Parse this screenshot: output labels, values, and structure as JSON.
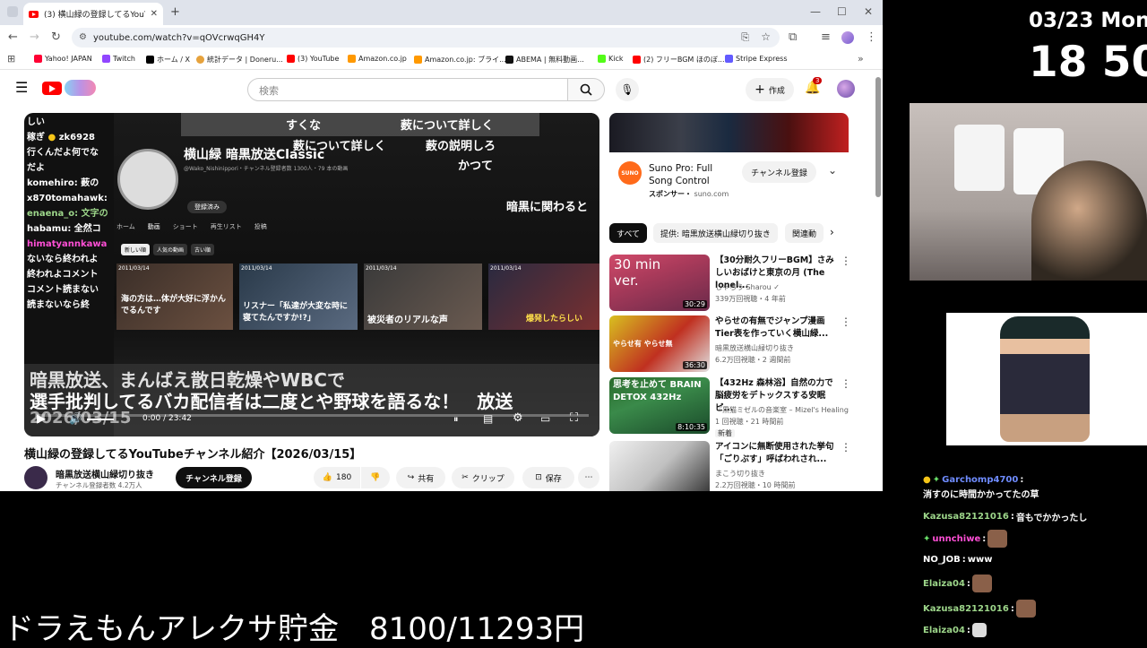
{
  "browser": {
    "tab_title": "(3) 横山緑の登録してるYouTubeチ",
    "url": "youtube.com/watch?v=qOVcrwqGH4Y",
    "bookmarks": [
      "Yahoo! JAPAN",
      "Twitch",
      "ホーム / X",
      "統計データ | Doneru...",
      "(3) YouTube",
      "Amazon.co.jp",
      "Amazon.co.jp: ブライ...",
      "ABEMA | 無料動画...",
      "Kick",
      "(2) フリーBGM ほのぼ...",
      "Stripe Express"
    ]
  },
  "youtube": {
    "search_placeholder": "検索",
    "create_label": "作成",
    "notification_count": "3",
    "video": {
      "title": "横山緑の登録してるYouTubeチャンネル紹介【2026/03/15】",
      "time": "0:00 / 23:42",
      "channel": "暗黒放送横山緑切り抜き",
      "subscribers": "チャンネル登録者数 4.2万人",
      "subscribe_label": "チャンネル登録",
      "likes": "180",
      "share_label": "共有",
      "clip_label": "クリップ",
      "save_label": "保存"
    },
    "overlay": {
      "top_comments": [
        "すくな",
        "薮について詳しく",
        "薮について詳しく",
        "薮の説明しろ",
        "かつて",
        "暗黒に関わると"
      ],
      "channel_name": "横山緑 暗黒放送Classic",
      "handle": "@Wako_Nishinippori・チャンネル登録者数 1300人・79 本の動画",
      "subscribed": "登録済み",
      "nav": [
        "ホーム",
        "動画",
        "ショート",
        "再生リスト",
        "投稿"
      ],
      "filters": [
        "新しい順",
        "人気の動画",
        "古い順"
      ],
      "left_chat": [
        "しい",
        "稼ぎ",
        "zk6928",
        "行くんだよ何でな",
        "だよ",
        "komehiro: 薮の",
        "x870tomahawk:",
        "enaena_o: 文字の",
        "habamu: 全然コ",
        "himatyannkawa",
        "ないなら終われよ",
        "終われよコメント",
        "コメント読まない",
        "読まないなら終"
      ],
      "bottom_text": "暗黒放送、まんばえ散日乾燥やWBCで",
      "bottom_text2": "選手批判してるバカ配信者は二度とや野球を語るな！　放送",
      "date": "2026/03/15",
      "thumb_captions": [
        "海の方は…体が大好に浮かんでるんです",
        "リスナー「私達が大変な時に寝てたんですか!?」",
        "被災者のリアルな声",
        "爆発したらしい"
      ],
      "thumb_dates": [
        "2011/03/14",
        "2011/03/14",
        "2011/03/14",
        "2011/03/14"
      ]
    },
    "ad": {
      "title": "Suno Pro: Full Song Control",
      "sponsor": "スポンサー・",
      "domain": "suno.com",
      "brand": "SUNO",
      "subscribe_label": "チャンネル登録"
    },
    "filter_chips": [
      "すべて",
      "提供: 暗黒放送横山緑切り抜き",
      "関連動"
    ],
    "recommendations": [
      {
        "title": "【30分耐久フリーBGM】さみしいおばけと東京の月 (The lonel...",
        "channel": "しゃろう Sharou",
        "meta": "339万回視聴・4 年前",
        "duration": "30:29",
        "thumb_text": "30 min ver."
      },
      {
        "title": "やらせの有無でジャンプ漫画Tier表を作っていく横山緑...",
        "channel": "暗黒放送横山緑切り抜き",
        "meta": "6.2万回視聴・2 週間前",
        "duration": "36:30",
        "thumb_text": "やらせ有 やらせ無"
      },
      {
        "title": "【432Hz 森林浴】自然の力で脳疲労をデトックスする安眠ピ...",
        "channel": "『黒猫ミゼルの音楽室 – Mizel's Healing ...",
        "meta": "1 回視聴・21 時間前",
        "badge": "新着",
        "duration": "8:10:35",
        "thumb_text": "思考を止めて BRAIN DETOX 432Hz"
      },
      {
        "title": "アイコンに無断使用された挙句「ごりぷす」呼ばわれされ...",
        "channel": "まこう切り抜き",
        "meta": "2.2万回視聴・10 時間前",
        "duration": "",
        "thumb_text": ""
      }
    ]
  },
  "stream": {
    "date": "03/23 Mon",
    "time": "18 50",
    "ticker": "ドラえもんアレクサ貯金　8100/11293円",
    "chat": [
      {
        "user": "Garchomp4700",
        "text": "消すのに時間かかってたの草",
        "color": "#6f8cff"
      },
      {
        "user": "Kazusa82121016",
        "text": "音もでかかったし",
        "color": "#9dd68a"
      },
      {
        "user": "unnchiwe",
        "text": "",
        "color": "#ff4fd6"
      },
      {
        "user": "NO_JOB",
        "text": "www",
        "color": "#ffffff"
      },
      {
        "user": "Elaiza04",
        "text": "",
        "color": "#9dd68a"
      },
      {
        "user": "Kazusa82121016",
        "text": "",
        "color": "#9dd68a"
      },
      {
        "user": "Elaiza04",
        "text": "",
        "color": "#9dd68a"
      }
    ]
  }
}
